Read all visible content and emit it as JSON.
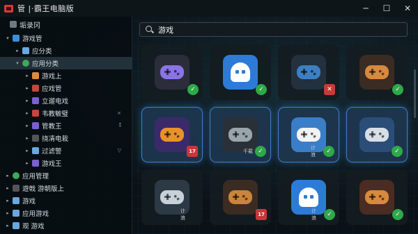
{
  "titlebar": {
    "title": "管 |·霸王电脑版"
  },
  "sidebar": {
    "header": "垢录冈",
    "items": [
      {
        "label": "游戏管",
        "level": 0
      },
      {
        "label": "应分类",
        "level": 1
      },
      {
        "label": "应用分类",
        "level": 1,
        "selected": true
      },
      {
        "label": "游戏上",
        "level": 2
      },
      {
        "label": "应戏管",
        "level": 2
      },
      {
        "label": "立遛电戏",
        "level": 2
      },
      {
        "label": "韦教敏璧",
        "level": 2,
        "tail": "×"
      },
      {
        "label": "管教王",
        "level": 2,
        "tail": "⁑"
      },
      {
        "label": "挠凊电栽",
        "level": 2
      },
      {
        "label": "过滤警",
        "level": 2,
        "tail": "▽"
      },
      {
        "label": "游戏王",
        "level": 2
      },
      {
        "label": "应用管理",
        "level": 0
      },
      {
        "label": "遊戟 游朝版上",
        "level": 0
      },
      {
        "label": "游戏",
        "level": 0
      },
      {
        "label": "应用游戏",
        "level": 0
      },
      {
        "label": "观 游戏",
        "level": 0
      }
    ]
  },
  "search": {
    "value": "游戏",
    "placeholder": ""
  },
  "tiles": [
    {
      "icon": "purple-gamepad-icon",
      "bg": "#2b2d3a",
      "color": "#8b74e6",
      "badge": "check"
    },
    {
      "icon": "blue-ghost-icon",
      "bg": "#2d7bd6",
      "badge": "check"
    },
    {
      "icon": "gear-gamepad-icon",
      "bg": "#22313d",
      "color": "#3d7fc2",
      "badge": "cross"
    },
    {
      "icon": "orange-tools-icon",
      "bg": "#3a2c22",
      "color": "#d7893e",
      "badge": "check"
    },
    {
      "icon": "sword-game-icon",
      "bg": "#3b2a6a",
      "color": "#e8922c",
      "badge": "red",
      "badge_text": "17"
    },
    {
      "icon": "space-pod-icon",
      "bg": "#2a3038",
      "color": "#9aa4ad",
      "badge": "check",
      "badge_text": "千载"
    },
    {
      "icon": "white-gamepad-icon",
      "bg": "#3b7ec8",
      "color": "#f2f2f2",
      "badge": "check",
      "badge_text": "计 浪"
    },
    {
      "icon": "blue-gamepad-icon",
      "bg": "#2a4e78",
      "color": "#d7dee6",
      "badge": "check"
    },
    {
      "icon": "grey-gamepad-icon",
      "bg": "#2c3a45",
      "color": "#c7d1d8",
      "badge": "text",
      "badge_text": "计 浪"
    },
    {
      "icon": "brown-gamepad-icon",
      "bg": "#3a2c22",
      "color": "#c9843e",
      "badge": "red",
      "badge_text": "17"
    },
    {
      "icon": "blue-ghost-icon",
      "bg": "#2d7bd6",
      "badge": "check",
      "badge_text": "计 浪"
    },
    {
      "icon": "disabled-tools-icon",
      "bg": "#4a2c22",
      "color": "#d7893e",
      "badge": "check"
    }
  ]
}
